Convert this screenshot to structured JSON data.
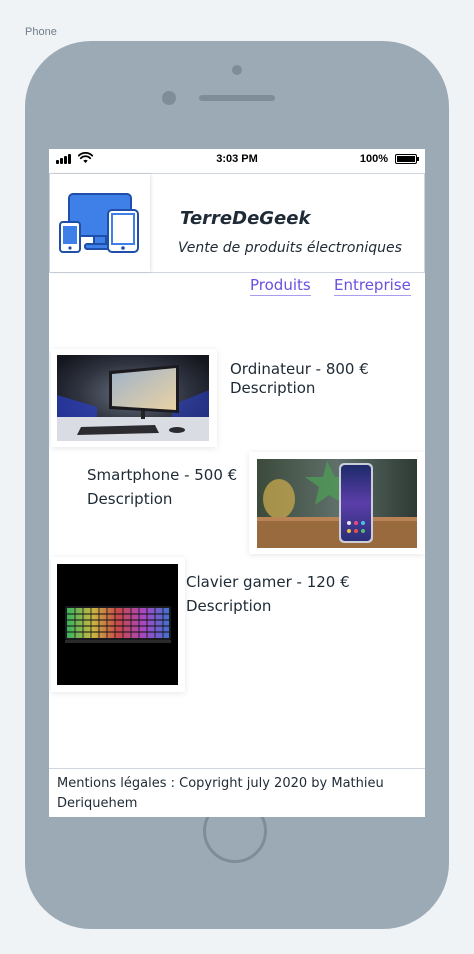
{
  "frame_label": "Phone",
  "status_bar": {
    "time": "3:03 PM",
    "battery": "100%"
  },
  "header": {
    "logo_icon": "devices-icon",
    "title": "TerreDeGeek",
    "tagline": "Vente de produits électroniques"
  },
  "nav": [
    {
      "label": "Produits"
    },
    {
      "label": "Entreprise"
    }
  ],
  "products": [
    {
      "name": "Ordinateur - 800 €",
      "description": "Description",
      "image": "computer-photo"
    },
    {
      "name": "Smartphone - 500 €",
      "description": "Description",
      "image": "smartphone-photo"
    },
    {
      "name": "Clavier gamer - 120 €",
      "description": "Description",
      "image": "keyboard-photo"
    }
  ],
  "footer": {
    "text": "Mentions légales : Copyright july 2020 by Mathieu Deriquehem"
  },
  "colors": {
    "accent": "#6b4fe0",
    "device_frame": "#9caab6",
    "logo_blue": "#3f7fe8"
  }
}
